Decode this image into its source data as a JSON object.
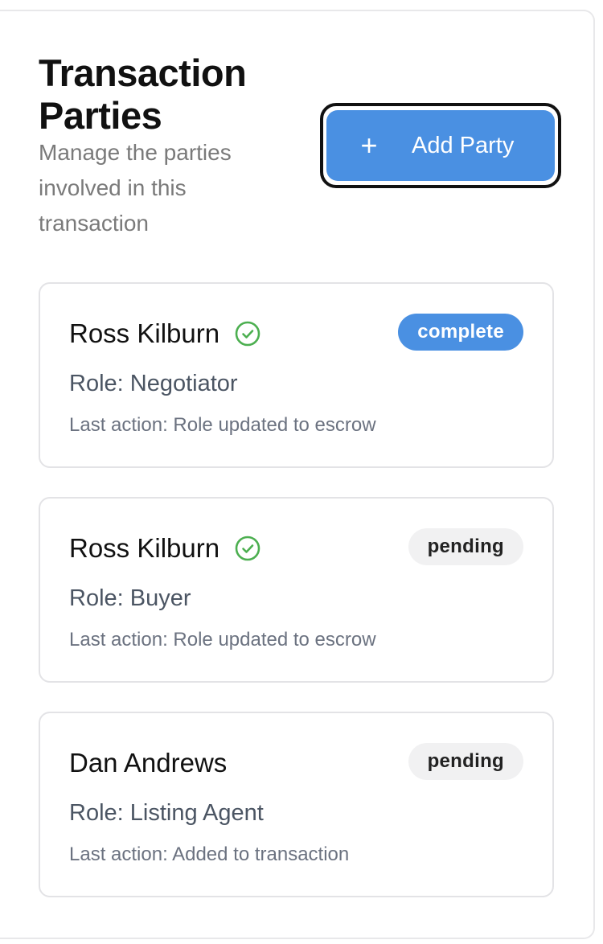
{
  "header": {
    "title": "Transaction Parties",
    "subtitle": "Manage the parties involved in this transaction",
    "add_button_icon": "plus-icon",
    "add_button_label": "Add Party"
  },
  "colors": {
    "accent": "#4a90e2",
    "verified": "#4caf50",
    "pending_badge_bg": "#f1f1f2"
  },
  "parties": [
    {
      "name": "Ross Kilburn",
      "verified": true,
      "verified_icon": "check-circle-icon",
      "status": "complete",
      "role": "Role: Negotiator",
      "last_action": "Last action: Role updated to escrow"
    },
    {
      "name": "Ross Kilburn",
      "verified": true,
      "verified_icon": "check-circle-icon",
      "status": "pending",
      "role": "Role: Buyer",
      "last_action": "Last action: Role updated to escrow"
    },
    {
      "name": "Dan Andrews",
      "verified": false,
      "status": "pending",
      "role": "Role: Listing Agent",
      "last_action": "Last action: Added to transaction"
    }
  ]
}
